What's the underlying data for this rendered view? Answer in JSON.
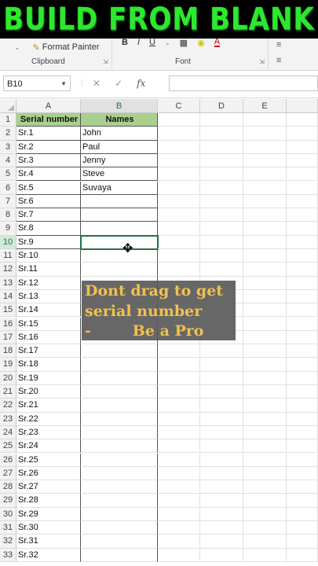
{
  "banner_title": "BUILD FROM BLANK",
  "ribbon": {
    "format_painter": "Format Painter",
    "clipboard_label": "Clipboard",
    "font_label": "Font"
  },
  "formula_bar": {
    "name_box": "B10",
    "fx": "fx",
    "value": ""
  },
  "columns": [
    "A",
    "B",
    "C",
    "D",
    "E"
  ],
  "headers": {
    "a": "Serial number",
    "b": "Names"
  },
  "rows": [
    {
      "n": "1",
      "a": "Serial number",
      "b": "Names"
    },
    {
      "n": "2",
      "a": "Sr.1",
      "b": "John"
    },
    {
      "n": "3",
      "a": "Sr.2",
      "b": "Paul"
    },
    {
      "n": "4",
      "a": "Sr.3",
      "b": "Jenny"
    },
    {
      "n": "5",
      "a": "Sr.4",
      "b": "Steve"
    },
    {
      "n": "6",
      "a": "Sr.5",
      "b": "Suvaya"
    },
    {
      "n": "7",
      "a": "Sr.6",
      "b": ""
    },
    {
      "n": "8",
      "a": "Sr.7",
      "b": ""
    },
    {
      "n": "9",
      "a": "Sr.8",
      "b": ""
    },
    {
      "n": "10",
      "a": "Sr.9",
      "b": ""
    },
    {
      "n": "11",
      "a": "Sr.10",
      "b": ""
    },
    {
      "n": "12",
      "a": "Sr.11",
      "b": ""
    },
    {
      "n": "13",
      "a": "Sr.12",
      "b": ""
    },
    {
      "n": "14",
      "a": "Sr.13",
      "b": ""
    },
    {
      "n": "15",
      "a": "Sr.14",
      "b": ""
    },
    {
      "n": "16",
      "a": "Sr.15",
      "b": ""
    },
    {
      "n": "17",
      "a": "Sr.16",
      "b": ""
    },
    {
      "n": "18",
      "a": "Sr.17",
      "b": ""
    },
    {
      "n": "19",
      "a": "Sr.18",
      "b": ""
    },
    {
      "n": "20",
      "a": "Sr.19",
      "b": ""
    },
    {
      "n": "21",
      "a": "Sr.20",
      "b": ""
    },
    {
      "n": "22",
      "a": "Sr.21",
      "b": ""
    },
    {
      "n": "23",
      "a": "Sr.22",
      "b": ""
    },
    {
      "n": "24",
      "a": "Sr.23",
      "b": ""
    },
    {
      "n": "25",
      "a": "Sr.24",
      "b": ""
    },
    {
      "n": "26",
      "a": "Sr.25",
      "b": ""
    },
    {
      "n": "27",
      "a": "Sr.26",
      "b": ""
    },
    {
      "n": "28",
      "a": "Sr.27",
      "b": ""
    },
    {
      "n": "29",
      "a": "Sr.28",
      "b": ""
    },
    {
      "n": "30",
      "a": "Sr.29",
      "b": ""
    },
    {
      "n": "31",
      "a": "Sr.30",
      "b": ""
    },
    {
      "n": "32",
      "a": "Sr.31",
      "b": ""
    },
    {
      "n": "33",
      "a": "Sr.32",
      "b": ""
    }
  ],
  "active_cell": "B10",
  "overlay": {
    "line1": "Dont drag to get",
    "line2": "serial number",
    "line3": "-        Be a Pro"
  },
  "colors": {
    "header_fill": "#a9d08e",
    "accent": "#217346",
    "banner_text": "#2ee82e",
    "overlay_text": "#f2c14e"
  }
}
